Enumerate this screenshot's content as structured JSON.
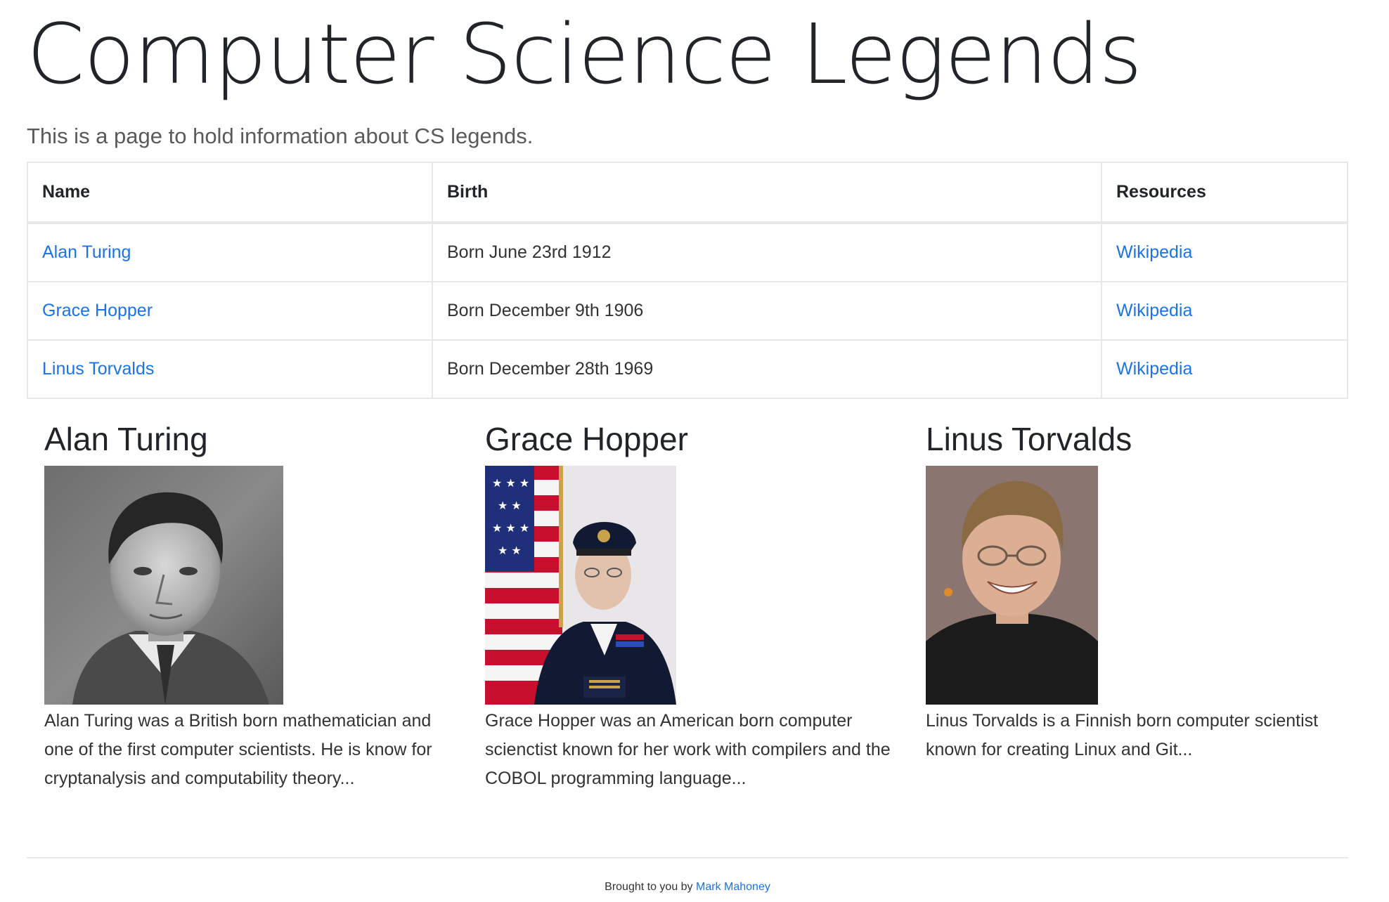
{
  "header": {
    "title": "Computer Science Legends",
    "subtitle": "This is a page to hold information about CS legends."
  },
  "table": {
    "headers": [
      "Name",
      "Birth",
      "Resources"
    ],
    "rows": [
      {
        "name": "Alan Turing",
        "birth": "Born June 23rd 1912",
        "resource": "Wikipedia"
      },
      {
        "name": "Grace Hopper",
        "birth": "Born December 9th 1906",
        "resource": "Wikipedia"
      },
      {
        "name": "Linus Torvalds",
        "birth": "Born December 28th 1969",
        "resource": "Wikipedia"
      }
    ]
  },
  "cards": [
    {
      "title": "Alan Turing",
      "text": "Alan Turing was a British born mathematician and one of the first computer scientists. He is know for cryptanalysis and computability theory..."
    },
    {
      "title": "Grace Hopper",
      "text": "Grace Hopper was an American born computer scienctist known for her work with compilers and the COBOL programming language..."
    },
    {
      "title": "Linus Torvalds",
      "text": "Linus Torvalds is a Finnish born computer scientist known for creating Linux and Git..."
    }
  ],
  "footer": {
    "prefix": "Brought to you by",
    "author_link": "Mark Mahoney"
  },
  "colors": {
    "link": "#1a73e8",
    "text": "#212529",
    "border": "#e6e8ea"
  }
}
